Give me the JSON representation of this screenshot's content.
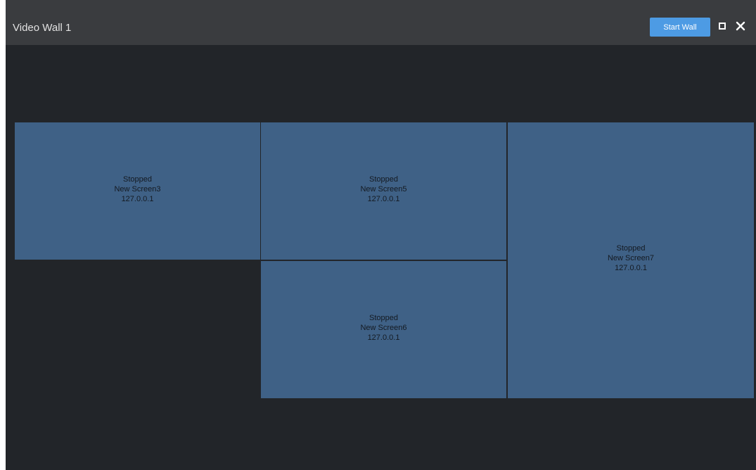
{
  "window": {
    "title": "Video Wall 1"
  },
  "toolbar": {
    "start_label": "Start Wall",
    "maximize_icon": "maximize-icon",
    "close_icon": "close-icon"
  },
  "colors": {
    "titlebar": "#3a3c3f",
    "background": "#222529",
    "screen": "#3f6186",
    "accent": "#4d9be4"
  },
  "screens": [
    {
      "status": "Stopped",
      "name": "New Screen3",
      "ip": "127.0.0.1"
    },
    {
      "status": "Stopped",
      "name": "New Screen5",
      "ip": "127.0.0.1"
    },
    {
      "status": "Stopped",
      "name": "New Screen6",
      "ip": "127.0.0.1"
    },
    {
      "status": "Stopped",
      "name": "New Screen7",
      "ip": "127.0.0.1"
    }
  ]
}
